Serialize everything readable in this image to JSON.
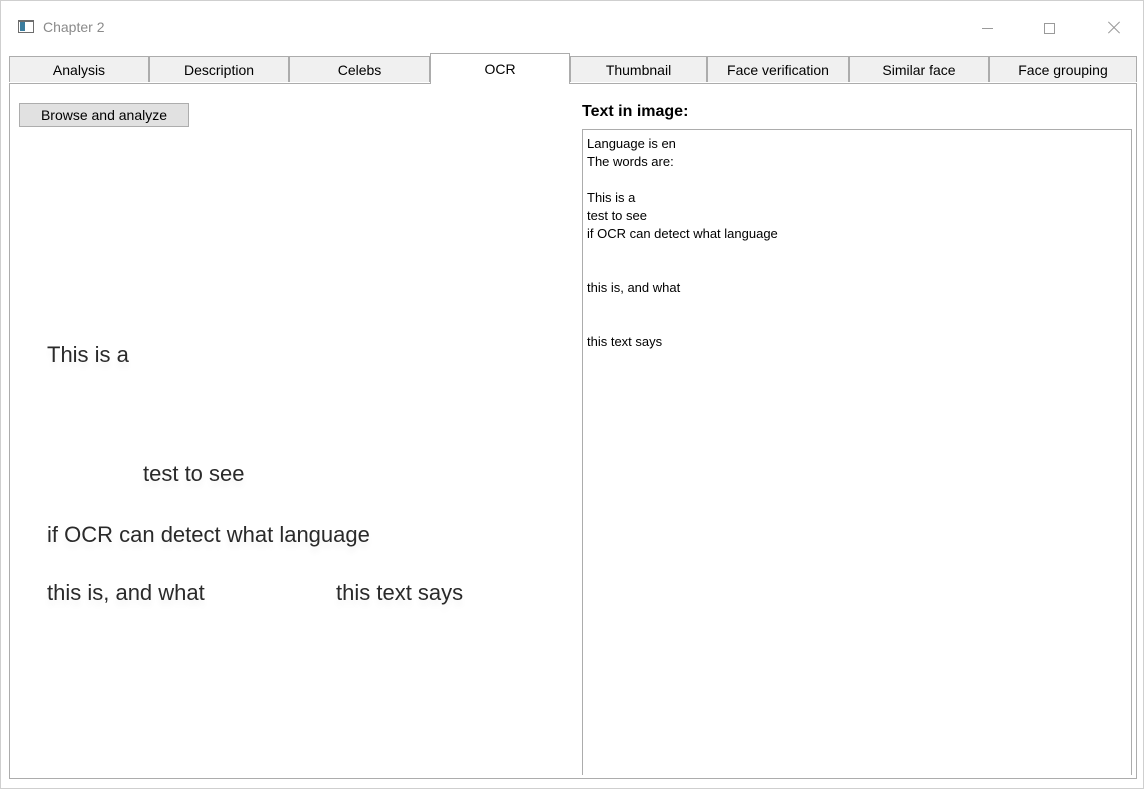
{
  "window": {
    "title": "Chapter 2",
    "icon": "app-window-icon",
    "controls": {
      "minimize_icon": "minimize-icon",
      "maximize_icon": "maximize-icon",
      "close_icon": "close-icon"
    }
  },
  "tabs": [
    {
      "label": "Analysis",
      "selected": false
    },
    {
      "label": "Description",
      "selected": false
    },
    {
      "label": "Celebs",
      "selected": false
    },
    {
      "label": "OCR",
      "selected": true
    },
    {
      "label": "Thumbnail",
      "selected": false
    },
    {
      "label": "Face verification",
      "selected": false
    },
    {
      "label": "Similar face",
      "selected": false
    },
    {
      "label": "Face grouping",
      "selected": false
    }
  ],
  "ocr_tab": {
    "browse_button_label": "Browse and analyze",
    "image_lines": {
      "line1": "This is a",
      "line2": "test to see",
      "line3": "if OCR can detect what language",
      "line4a": "this is, and what",
      "line4b": "this text says"
    },
    "result_heading": "Text in image:",
    "result_lines": [
      "Language is en",
      "The words are:",
      "",
      "This is a",
      "test to see",
      "if OCR can detect what language",
      "",
      "",
      "this is, and what",
      "",
      "",
      "this text says"
    ]
  }
}
